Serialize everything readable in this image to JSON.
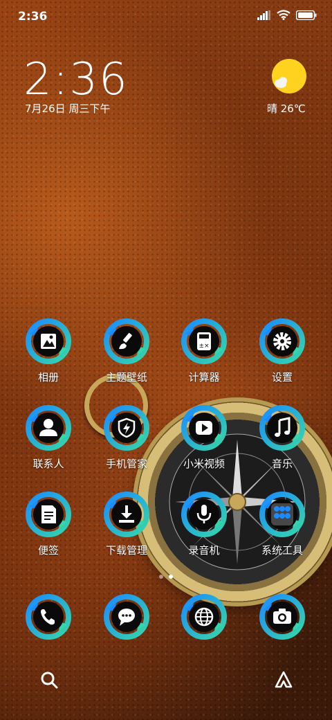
{
  "status_bar": {
    "time": "2:36"
  },
  "widget": {
    "clock": "2:36",
    "date": "7月26日 周三下午",
    "weather": "晴 26℃"
  },
  "apps": [
    {
      "label": "相册",
      "icon": "gallery-icon"
    },
    {
      "label": "主题壁纸",
      "icon": "paintbrush-icon"
    },
    {
      "label": "计算器",
      "icon": "calculator-icon"
    },
    {
      "label": "设置",
      "icon": "gear-icon"
    },
    {
      "label": "联系人",
      "icon": "person-icon"
    },
    {
      "label": "手机管家",
      "icon": "shield-bolt-icon"
    },
    {
      "label": "小米视频",
      "icon": "play-icon"
    },
    {
      "label": "音乐",
      "icon": "music-note-icon"
    },
    {
      "label": "便签",
      "icon": "note-icon"
    },
    {
      "label": "下载管理",
      "icon": "download-icon"
    },
    {
      "label": "录音机",
      "icon": "microphone-icon"
    },
    {
      "label": "系统工具",
      "icon": "folder-icon"
    }
  ],
  "dock": [
    {
      "icon": "phone-icon"
    },
    {
      "icon": "message-icon"
    },
    {
      "icon": "globe-icon"
    },
    {
      "icon": "camera-icon"
    }
  ],
  "page_indicator": {
    "pages": 2,
    "active": 2
  },
  "colors": {
    "icon_ring_a": "#1a8cff",
    "icon_ring_b": "#36d6a8",
    "icon_bg": "#0a0a0a",
    "sun": "#ffd21f"
  }
}
